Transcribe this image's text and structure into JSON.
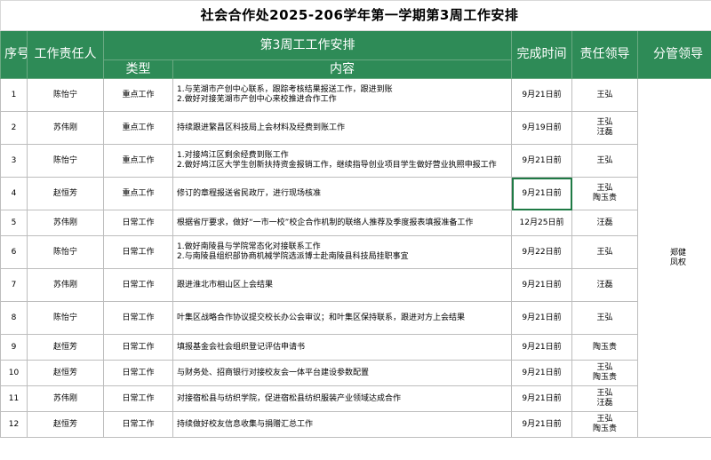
{
  "title": "社会合作处2025-206学年第一学期第3周工作安排",
  "headers": {
    "seq": "序号",
    "owner": "工作责任人",
    "plan": "第3周工工作安排",
    "type": "类型",
    "content": "内容",
    "deadline": "完成时间",
    "leader": "责任领导",
    "supervisor": "分管领导"
  },
  "supervisor_value": [
    "郑健",
    "凤权"
  ],
  "rows": [
    {
      "no": "1",
      "owner": "陈怡宁",
      "type": "重点工作",
      "content": [
        "1.与芜湖市产创中心联系，跟踪考核结果报送工作，跟进到账",
        "2.做好对接芜湖市产创中心来校推进合作工作"
      ],
      "deadline": "9月21日前",
      "leader": [
        "王弘"
      ]
    },
    {
      "no": "2",
      "owner": "苏伟刚",
      "type": "重点工作",
      "content": [
        "持续跟进繁昌区科技局上会材料及经费到账工作"
      ],
      "deadline": "9月19日前",
      "leader": [
        "王弘",
        "汪磊"
      ]
    },
    {
      "no": "3",
      "owner": "陈怡宁",
      "type": "重点工作",
      "content": [
        "1.对接鸠江区剩余经费到账工作",
        "2.做好鸠江区大学生创新扶持资金报销工作，继续指导创业项目学生做好营业执照申报工作"
      ],
      "deadline": "9月21日前",
      "leader": [
        "王弘"
      ]
    },
    {
      "no": "4",
      "owner": "赵恒芳",
      "type": "重点工作",
      "content": [
        "修订的章程报送省民政厅，进行现场核准"
      ],
      "deadline": "9月21日前",
      "leader": [
        "王弘",
        "陶玉贵"
      ]
    },
    {
      "no": "5",
      "owner": "苏伟刚",
      "type": "日常工作",
      "content": [
        "根据省厅要求，做好“一市一校”校企合作机制的联络人推荐及季度报表填报准备工作"
      ],
      "deadline": "12月25日前",
      "leader": [
        "汪磊"
      ]
    },
    {
      "no": "6",
      "owner": "陈怡宁",
      "type": "日常工作",
      "content": [
        "1.做好南陵县与学院常态化对接联系工作",
        "2.与南陵县组织部协商机械学院选派博士赴南陵县科技局挂职事宜"
      ],
      "deadline": "9月22日前",
      "leader": [
        "王弘"
      ]
    },
    {
      "no": "7",
      "owner": "苏伟刚",
      "type": "日常工作",
      "content": [
        "跟进淮北市相山区上会结果"
      ],
      "deadline": "9月21日前",
      "leader": [
        "汪磊"
      ]
    },
    {
      "no": "8",
      "owner": "陈怡宁",
      "type": "日常工作",
      "content": [
        "叶集区战略合作协议提交校长办公会审议；和叶集区保持联系，跟进对方上会结果"
      ],
      "deadline": "9月21日前",
      "leader": [
        "王弘"
      ]
    },
    {
      "no": "9",
      "owner": "赵恒芳",
      "type": "日常工作",
      "content": [
        "填报基金会社会组织登记评估申请书"
      ],
      "deadline": "9月21日前",
      "leader": [
        "陶玉贵"
      ]
    },
    {
      "no": "10",
      "owner": "赵恒芳",
      "type": "日常工作",
      "content": [
        "与财务处、招商银行对接校友会一体平台建设参数配置"
      ],
      "deadline": "9月21日前",
      "leader": [
        "王弘",
        "陶玉贵"
      ]
    },
    {
      "no": "11",
      "owner": "苏伟刚",
      "type": "日常工作",
      "content": [
        "对接宿松县与纺织学院，促进宿松县纺织服装产业领域达成合作"
      ],
      "deadline": "9月21日前",
      "leader": [
        "王弘",
        "汪磊"
      ]
    },
    {
      "no": "12",
      "owner": "赵恒芳",
      "type": "日常工作",
      "content": [
        "持续做好校友信息收集与捐赠汇总工作"
      ],
      "deadline": "9月21日前",
      "leader": [
        "王弘",
        "陶玉贵"
      ]
    }
  ]
}
